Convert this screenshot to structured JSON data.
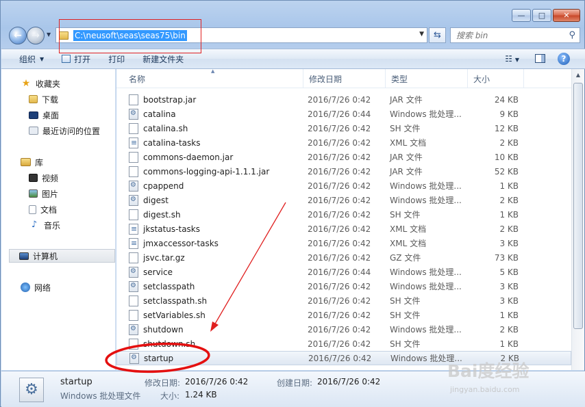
{
  "window": {
    "minimize": "—",
    "maximize": "□",
    "close": "✕"
  },
  "address": {
    "path": "C:\\neusoft\\seas\\seas75\\bin",
    "search_placeholder": "搜索 bin"
  },
  "toolbar": {
    "organize": "组织",
    "open": "打开",
    "print": "打印",
    "new_folder": "新建文件夹"
  },
  "nav": {
    "favorites": "收藏夹",
    "downloads": "下载",
    "desktop": "桌面",
    "recent": "最近访问的位置",
    "libraries": "库",
    "videos": "视频",
    "pictures": "图片",
    "documents": "文档",
    "music": "音乐",
    "computer": "计算机",
    "network": "网络"
  },
  "columns": {
    "name": "名称",
    "date": "修改日期",
    "type": "类型",
    "size": "大小"
  },
  "files": [
    {
      "name": "bootstrap.jar",
      "date": "2016/7/26 0:42",
      "type": "JAR 文件",
      "size": "24 KB",
      "icon": "jar"
    },
    {
      "name": "catalina",
      "date": "2016/7/26 0:44",
      "type": "Windows 批处理...",
      "size": "9 KB",
      "icon": "bat"
    },
    {
      "name": "catalina.sh",
      "date": "2016/7/26 0:42",
      "type": "SH 文件",
      "size": "12 KB",
      "icon": "sh"
    },
    {
      "name": "catalina-tasks",
      "date": "2016/7/26 0:42",
      "type": "XML 文档",
      "size": "2 KB",
      "icon": "xml"
    },
    {
      "name": "commons-daemon.jar",
      "date": "2016/7/26 0:42",
      "type": "JAR 文件",
      "size": "10 KB",
      "icon": "jar"
    },
    {
      "name": "commons-logging-api-1.1.1.jar",
      "date": "2016/7/26 0:42",
      "type": "JAR 文件",
      "size": "52 KB",
      "icon": "jar"
    },
    {
      "name": "cpappend",
      "date": "2016/7/26 0:42",
      "type": "Windows 批处理...",
      "size": "1 KB",
      "icon": "bat"
    },
    {
      "name": "digest",
      "date": "2016/7/26 0:42",
      "type": "Windows 批处理...",
      "size": "2 KB",
      "icon": "bat"
    },
    {
      "name": "digest.sh",
      "date": "2016/7/26 0:42",
      "type": "SH 文件",
      "size": "1 KB",
      "icon": "sh"
    },
    {
      "name": "jkstatus-tasks",
      "date": "2016/7/26 0:42",
      "type": "XML 文档",
      "size": "2 KB",
      "icon": "xml"
    },
    {
      "name": "jmxaccessor-tasks",
      "date": "2016/7/26 0:42",
      "type": "XML 文档",
      "size": "3 KB",
      "icon": "xml"
    },
    {
      "name": "jsvc.tar.gz",
      "date": "2016/7/26 0:42",
      "type": "GZ 文件",
      "size": "73 KB",
      "icon": "gz"
    },
    {
      "name": "service",
      "date": "2016/7/26 0:44",
      "type": "Windows 批处理...",
      "size": "5 KB",
      "icon": "bat"
    },
    {
      "name": "setclasspath",
      "date": "2016/7/26 0:42",
      "type": "Windows 批处理...",
      "size": "3 KB",
      "icon": "bat"
    },
    {
      "name": "setclasspath.sh",
      "date": "2016/7/26 0:42",
      "type": "SH 文件",
      "size": "3 KB",
      "icon": "sh"
    },
    {
      "name": "setVariables.sh",
      "date": "2016/7/26 0:42",
      "type": "SH 文件",
      "size": "1 KB",
      "icon": "sh"
    },
    {
      "name": "shutdown",
      "date": "2016/7/26 0:42",
      "type": "Windows 批处理...",
      "size": "2 KB",
      "icon": "bat"
    },
    {
      "name": "shutdown.sh",
      "date": "2016/7/26 0:42",
      "type": "SH 文件",
      "size": "1 KB",
      "icon": "sh"
    },
    {
      "name": "startup",
      "date": "2016/7/26 0:42",
      "type": "Windows 批处理...",
      "size": "2 KB",
      "icon": "bat",
      "selected": true
    }
  ],
  "details": {
    "name": "startup",
    "type": "Windows 批处理文件",
    "modified_label": "修改日期:",
    "modified": "2016/7/26 0:42",
    "created_label": "创建日期:",
    "created": "2016/7/26 0:42",
    "size_label": "大小:",
    "size": "1.24 KB"
  },
  "watermark": {
    "logo": "Bai度经验",
    "sub": "jingyan.baidu.com"
  },
  "colors": {
    "selection": "#3399ff",
    "annotation": "#e02020"
  }
}
